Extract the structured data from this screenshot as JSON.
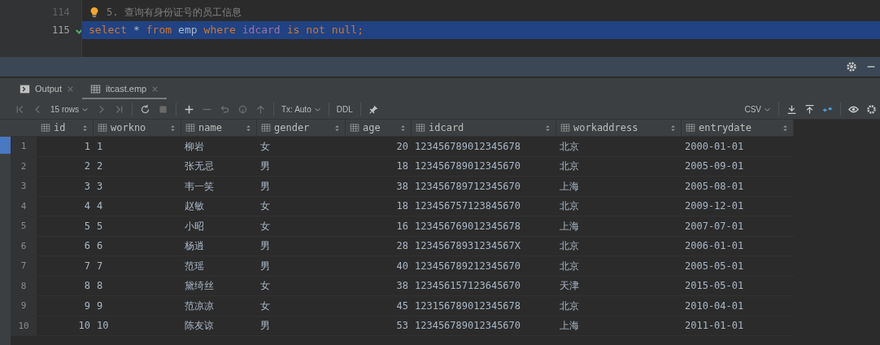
{
  "editor": {
    "lines": [
      {
        "number": "114",
        "kind": "comment",
        "text": "5. 查询有身份证号的员工信息",
        "selected": false
      },
      {
        "number": "115",
        "kind": "code",
        "selected": true,
        "checked": true,
        "tokens": [
          {
            "kind": "keyword",
            "text": "select"
          },
          {
            "kind": "plain",
            "text": "*"
          },
          {
            "kind": "keyword",
            "text": "from"
          },
          {
            "kind": "table",
            "text": "emp"
          },
          {
            "kind": "keyword",
            "text": "where"
          },
          {
            "kind": "column",
            "text": "idcard"
          },
          {
            "kind": "keyword",
            "text": "is"
          },
          {
            "kind": "keyword",
            "text": "not"
          },
          {
            "kind": "keyword",
            "text": "null;"
          }
        ]
      }
    ]
  },
  "tabs": [
    {
      "label": "Output",
      "kind": "console",
      "selected": false
    },
    {
      "label": "itcast.emp",
      "kind": "table",
      "selected": true
    }
  ],
  "toolbar": {
    "rows": "15 rows",
    "tx": "Tx: Auto",
    "ddl": "DDL",
    "format": "CSV"
  },
  "table": {
    "columns": [
      "id",
      "workno",
      "name",
      "gender",
      "age",
      "idcard",
      "workaddress",
      "entrydate"
    ],
    "rows": [
      {
        "row": "1",
        "cells": [
          "1",
          "1",
          "柳岩",
          "女",
          "20",
          "123456789012345678",
          "北京",
          "2000-01-01"
        ]
      },
      {
        "row": "2",
        "cells": [
          "2",
          "2",
          "张无忌",
          "男",
          "18",
          "123456789012345670",
          "北京",
          "2005-09-01"
        ]
      },
      {
        "row": "3",
        "cells": [
          "3",
          "3",
          "韦一笑",
          "男",
          "38",
          "123456789712345670",
          "上海",
          "2005-08-01"
        ]
      },
      {
        "row": "4",
        "cells": [
          "4",
          "4",
          "赵敏",
          "女",
          "18",
          "123456757123845670",
          "北京",
          "2009-12-01"
        ]
      },
      {
        "row": "5",
        "cells": [
          "5",
          "5",
          "小昭",
          "女",
          "16",
          "123456769012345678",
          "上海",
          "2007-07-01"
        ]
      },
      {
        "row": "6",
        "cells": [
          "6",
          "6",
          "杨逍",
          "男",
          "28",
          "12345678931234567X",
          "北京",
          "2006-01-01"
        ]
      },
      {
        "row": "7",
        "cells": [
          "7",
          "7",
          "范瑶",
          "男",
          "40",
          "123456789212345670",
          "北京",
          "2005-05-01"
        ]
      },
      {
        "row": "8",
        "cells": [
          "8",
          "8",
          "黛绮丝",
          "女",
          "38",
          "123456157123645670",
          "天津",
          "2015-05-01"
        ]
      },
      {
        "row": "9",
        "cells": [
          "9",
          "9",
          "范凉凉",
          "女",
          "45",
          "123156789012345678",
          "北京",
          "2010-04-01"
        ]
      },
      {
        "row": "10",
        "cells": [
          "10",
          "10",
          "陈友谅",
          "男",
          "53",
          "123456789012345670",
          "上海",
          "2011-01-01"
        ]
      }
    ]
  }
}
